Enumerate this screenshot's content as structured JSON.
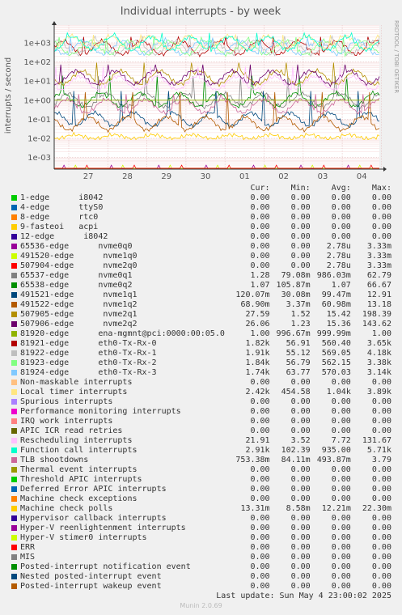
{
  "chart_data": {
    "type": "line",
    "title": "Individual interrupts - by week",
    "ylabel": "interrupts / second",
    "side_label": "RRDTOOL / TOBI OETIKER",
    "scale": "log",
    "ylim": [
      0.0003,
      4000
    ],
    "yticks": [
      "1e+03",
      "1e+02",
      "1e+01",
      "1e+00",
      "1e-01",
      "1e-02",
      "1e-03"
    ],
    "xticks": [
      "27",
      "28",
      "29",
      "30",
      "01",
      "02",
      "03",
      "04"
    ],
    "grid": true,
    "columns": [
      "Cur:",
      "Min:",
      "Avg:",
      "Max:"
    ],
    "series": [
      {
        "name": "1-edge      i8042",
        "color": "#00cc00",
        "cur": "0.00",
        "min": "0.00",
        "avg": "0.00",
        "max": "0.00"
      },
      {
        "name": "4-edge      ttyS0",
        "color": "#0066b3",
        "cur": "0.00",
        "min": "0.00",
        "avg": "0.00",
        "max": "0.00"
      },
      {
        "name": "8-edge      rtc0",
        "color": "#ff8000",
        "cur": "0.00",
        "min": "0.00",
        "avg": "0.00",
        "max": "0.00"
      },
      {
        "name": "9-fasteoi   acpi",
        "color": "#ffcc00",
        "cur": "0.00",
        "min": "0.00",
        "avg": "0.00",
        "max": "0.00"
      },
      {
        "name": "12-edge      i8042",
        "color": "#330099",
        "cur": "0.00",
        "min": "0.00",
        "avg": "0.00",
        "max": "0.00"
      },
      {
        "name": "65536-edge      nvme0q0",
        "color": "#990099",
        "cur": "0.00",
        "min": "0.00",
        "avg": "2.78u",
        "max": "3.33m"
      },
      {
        "name": "491520-edge      nvme1q0",
        "color": "#ccff00",
        "cur": "0.00",
        "min": "0.00",
        "avg": "2.78u",
        "max": "3.33m"
      },
      {
        "name": "507904-edge      nvme2q0",
        "color": "#ff0000",
        "cur": "0.00",
        "min": "0.00",
        "avg": "2.78u",
        "max": "3.33m"
      },
      {
        "name": "65537-edge      nvme0q1",
        "color": "#808080",
        "cur": "1.28",
        "min": "79.08m",
        "avg": "986.03m",
        "max": "62.79"
      },
      {
        "name": "65538-edge      nvme0q2",
        "color": "#008f00",
        "cur": "1.07",
        "min": "105.87m",
        "avg": "1.07",
        "max": "66.67"
      },
      {
        "name": "491521-edge      nvme1q1",
        "color": "#00487d",
        "cur": "120.07m",
        "min": "30.08m",
        "avg": "99.47m",
        "max": "12.91"
      },
      {
        "name": "491522-edge      nvme1q2",
        "color": "#b35a00",
        "cur": "68.90m",
        "min": "3.37m",
        "avg": "60.98m",
        "max": "13.18"
      },
      {
        "name": "507905-edge      nvme2q1",
        "color": "#b38f00",
        "cur": "27.59",
        "min": "1.52",
        "avg": "15.42",
        "max": "198.39"
      },
      {
        "name": "507906-edge      nvme2q2",
        "color": "#6b006b",
        "cur": "26.06",
        "min": "1.23",
        "avg": "15.36",
        "max": "143.62"
      },
      {
        "name": "81920-edge      ena-mgmnt@pci:0000:00:05.0",
        "color": "#8fb300",
        "cur": "1.00",
        "min": "996.67m",
        "avg": "999.99m",
        "max": "1.00"
      },
      {
        "name": "81921-edge      eth0-Tx-Rx-0",
        "color": "#b30000",
        "cur": "1.82k",
        "min": "56.91",
        "avg": "560.40",
        "max": "3.65k"
      },
      {
        "name": "81922-edge      eth0-Tx-Rx-1",
        "color": "#bebebe",
        "cur": "1.91k",
        "min": "55.12",
        "avg": "569.05",
        "max": "4.18k"
      },
      {
        "name": "81923-edge      eth0-Tx-Rx-2",
        "color": "#80ff80",
        "cur": "1.84k",
        "min": "56.79",
        "avg": "562.15",
        "max": "3.38k"
      },
      {
        "name": "81924-edge      eth0-Tx-Rx-3",
        "color": "#80c9ff",
        "cur": "1.74k",
        "min": "63.77",
        "avg": "570.03",
        "max": "3.14k"
      },
      {
        "name": "Non-maskable interrupts",
        "color": "#ffc080",
        "cur": "0.00",
        "min": "0.00",
        "avg": "0.00",
        "max": "0.00"
      },
      {
        "name": "Local timer interrupts",
        "color": "#ffe680",
        "cur": "2.42k",
        "min": "454.58",
        "avg": "1.04k",
        "max": "3.89k"
      },
      {
        "name": "Spurious interrupts",
        "color": "#aa80ff",
        "cur": "0.00",
        "min": "0.00",
        "avg": "0.00",
        "max": "0.00"
      },
      {
        "name": "Performance monitoring interrupts",
        "color": "#ee00cc",
        "cur": "0.00",
        "min": "0.00",
        "avg": "0.00",
        "max": "0.00"
      },
      {
        "name": "IRQ work interrupts",
        "color": "#ff8080",
        "cur": "0.00",
        "min": "0.00",
        "avg": "0.00",
        "max": "0.00"
      },
      {
        "name": "APIC ICR read retries",
        "color": "#666600",
        "cur": "0.00",
        "min": "0.00",
        "avg": "0.00",
        "max": "0.00"
      },
      {
        "name": "Rescheduling interrupts",
        "color": "#ffbfff",
        "cur": "21.91",
        "min": "3.52",
        "avg": "7.72",
        "max": "131.67"
      },
      {
        "name": "Function call interrupts",
        "color": "#00ffcc",
        "cur": "2.91k",
        "min": "102.39",
        "avg": "935.00",
        "max": "5.71k"
      },
      {
        "name": "TLB shootdowns",
        "color": "#cc6699",
        "cur": "753.38m",
        "min": "84.11m",
        "avg": "493.87m",
        "max": "3.79"
      },
      {
        "name": "Thermal event interrupts",
        "color": "#999900",
        "cur": "0.00",
        "min": "0.00",
        "avg": "0.00",
        "max": "0.00"
      },
      {
        "name": "Threshold APIC interrupts",
        "color": "#00cc00",
        "cur": "0.00",
        "min": "0.00",
        "avg": "0.00",
        "max": "0.00"
      },
      {
        "name": "Deferred Error APIC interrupts",
        "color": "#0066b3",
        "cur": "0.00",
        "min": "0.00",
        "avg": "0.00",
        "max": "0.00"
      },
      {
        "name": "Machine check exceptions",
        "color": "#ff8000",
        "cur": "0.00",
        "min": "0.00",
        "avg": "0.00",
        "max": "0.00"
      },
      {
        "name": "Machine check polls",
        "color": "#ffcc00",
        "cur": "13.31m",
        "min": "8.58m",
        "avg": "12.21m",
        "max": "22.30m"
      },
      {
        "name": "Hypervisor callback interrupts",
        "color": "#330099",
        "cur": "0.00",
        "min": "0.00",
        "avg": "0.00",
        "max": "0.00"
      },
      {
        "name": "Hyper-V reenlightenment interrupts",
        "color": "#990099",
        "cur": "0.00",
        "min": "0.00",
        "avg": "0.00",
        "max": "0.00"
      },
      {
        "name": "Hyper-V stimer0 interrupts",
        "color": "#ccff00",
        "cur": "0.00",
        "min": "0.00",
        "avg": "0.00",
        "max": "0.00"
      },
      {
        "name": "ERR",
        "color": "#ff0000",
        "cur": "0.00",
        "min": "0.00",
        "avg": "0.00",
        "max": "0.00"
      },
      {
        "name": "MIS",
        "color": "#808080",
        "cur": "0.00",
        "min": "0.00",
        "avg": "0.00",
        "max": "0.00"
      },
      {
        "name": "Posted-interrupt notification event",
        "color": "#008f00",
        "cur": "0.00",
        "min": "0.00",
        "avg": "0.00",
        "max": "0.00"
      },
      {
        "name": "Nested posted-interrupt event",
        "color": "#00487d",
        "cur": "0.00",
        "min": "0.00",
        "avg": "0.00",
        "max": "0.00"
      },
      {
        "name": "Posted-interrupt wakeup event",
        "color": "#b35a00",
        "cur": "0.00",
        "min": "0.00",
        "avg": "0.00",
        "max": "0.00"
      }
    ]
  },
  "footer": {
    "last_update": "Last update: Sun May  4 23:00:02 2025",
    "generator": "Munin 2.0.69"
  }
}
